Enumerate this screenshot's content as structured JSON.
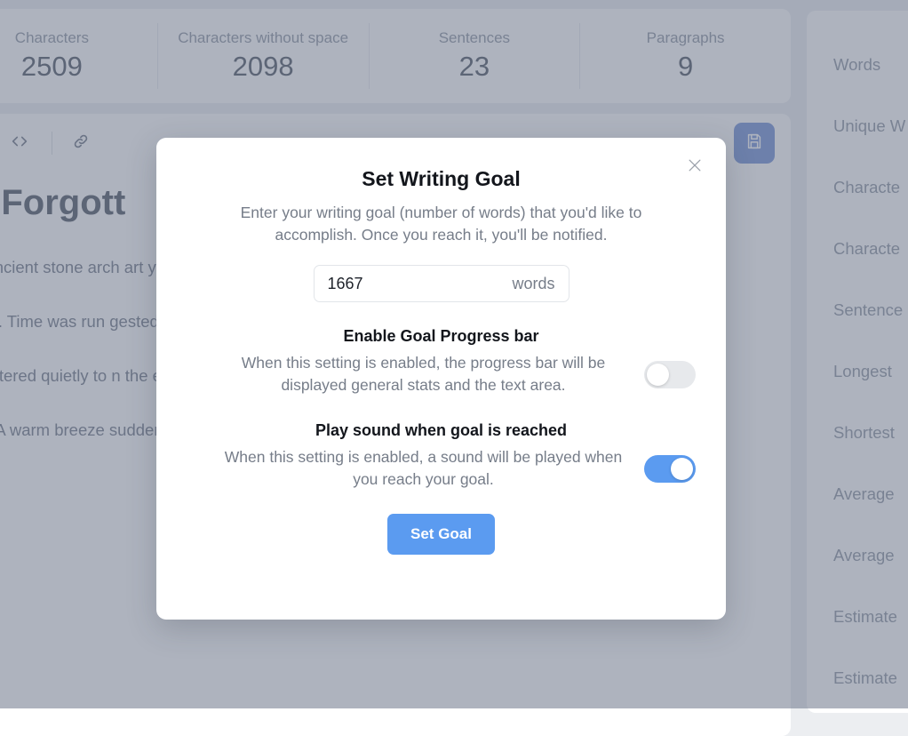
{
  "stats_bar": {
    "items": [
      {
        "label": "Characters",
        "value": "2509"
      },
      {
        "label": "Characters without space",
        "value": "2098"
      },
      {
        "label": "Sentences",
        "value": "23"
      },
      {
        "label": "Paragraphs",
        "value": "9"
      }
    ]
  },
  "toolbar": {
    "quote_icon": "quote-icon",
    "code_icon": "code-icon",
    "link_icon": "link-icon",
    "save_icon": "save-icon"
  },
  "document": {
    "title": "e Forgott",
    "paragraphs": [
      "e ancient stone arch                                                                                                             art y examined the mys een centuries ago. T y matched her curr",
      "ook. Time was run gested that the gat stone at dawn. This owadays merely re",
      "muttered quietly to                                                                   n the e literally depended d in d in exactly three days' time.",
      "tly. A warm breeze suddenly stirred the leaves around her feet, despite the chilly autumn"
    ]
  },
  "side_panel": {
    "rows": [
      {
        "label": "Words"
      },
      {
        "label": "Unique W"
      },
      {
        "label": "Characte"
      },
      {
        "label": "Characte"
      },
      {
        "label": "Sentence"
      },
      {
        "label": "Longest "
      },
      {
        "label": "Shortest"
      },
      {
        "label": "Average "
      },
      {
        "label": "Average "
      },
      {
        "label": "Estimate"
      },
      {
        "label": "Estimate"
      }
    ]
  },
  "modal": {
    "title": "Set Writing Goal",
    "description": "Enter your writing goal (number of words) that you'd like to accomplish. Once you reach it, you'll be notified.",
    "close_icon": "close-icon",
    "goal_value": "1667",
    "goal_placeholder": "1667",
    "goal_unit": "words",
    "settings": [
      {
        "title": "Enable Goal Progress bar",
        "description": "When this setting is enabled, the progress bar will be displayed general stats and the text area.",
        "enabled": false
      },
      {
        "title": "Play sound when goal is reached",
        "description": "When this setting is enabled, a sound will be played when you reach your goal.",
        "enabled": true
      }
    ],
    "submit_label": "Set Goal"
  },
  "colors": {
    "accent": "#5b9bf0",
    "save_button": "#6f8fd6",
    "toggle_off": "#e7e9ec",
    "text_muted": "#767d89",
    "text_dark": "#13161c"
  }
}
